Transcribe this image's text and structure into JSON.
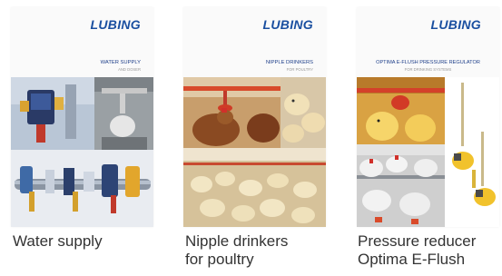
{
  "cards": [
    {
      "brand": "LUBING",
      "heading": "WATER SUPPLY",
      "subheading": "AND DOSER",
      "caption_lines": [
        "Water supply"
      ]
    },
    {
      "brand": "LUBING",
      "heading": "NIPPLE DRINKERS",
      "subheading": "FOR POULTRY",
      "caption_lines": [
        "Nipple drinkers",
        "for poultry"
      ]
    },
    {
      "brand": "LUBING",
      "heading": "OPTIMA E-FLUSH PRESSURE REGULATOR",
      "subheading": "FOR DRINKING SYSTEMS",
      "caption_lines": [
        "Pressure reducer",
        "Optima E-Flush"
      ]
    }
  ],
  "colors": {
    "brand_blue": "#1a4fa0",
    "heading_blue": "#1e3f8a",
    "caption_text": "#333333"
  }
}
